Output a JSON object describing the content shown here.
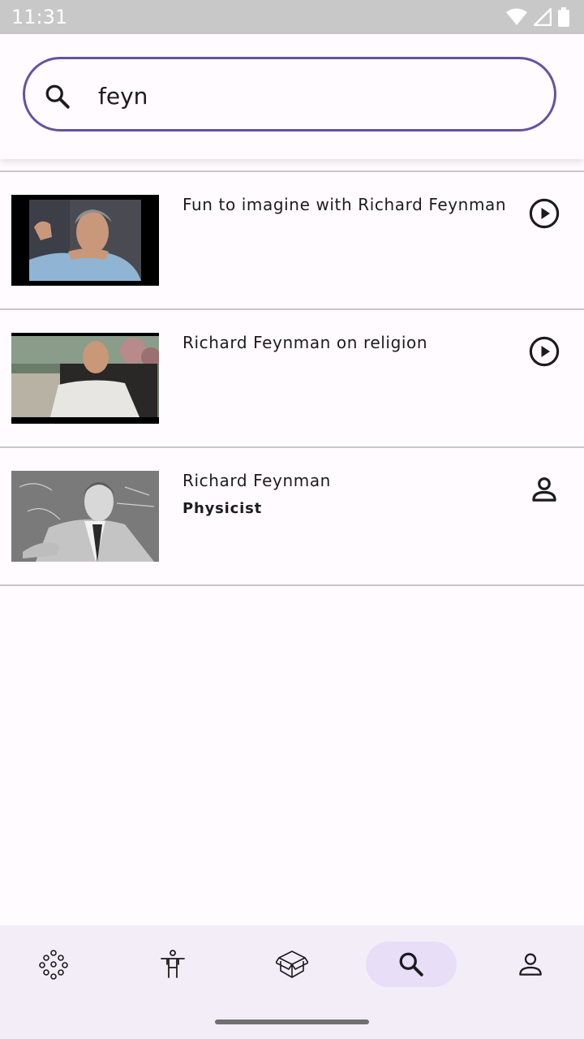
{
  "status_bar": {
    "time": "11:31"
  },
  "search": {
    "query": "feyn"
  },
  "results": [
    {
      "title": "Fun to imagine with Richard Feynman",
      "subtitle": "",
      "type": "video",
      "action_icon": "play-circle-icon"
    },
    {
      "title": "Richard Feynman on religion",
      "subtitle": "",
      "type": "video",
      "action_icon": "play-circle-icon"
    },
    {
      "title": "Richard Feynman",
      "subtitle": "Physicist",
      "type": "person",
      "action_icon": "person-icon"
    }
  ],
  "bottom_nav": {
    "items": [
      {
        "icon": "molecules-icon",
        "active": false
      },
      {
        "icon": "accessibility-icon",
        "active": false
      },
      {
        "icon": "box-icon",
        "active": false
      },
      {
        "icon": "search-icon",
        "active": true
      },
      {
        "icon": "person-icon",
        "active": false
      }
    ]
  },
  "colors": {
    "accent": "#6750a4",
    "active_pill": "#e8def8",
    "nav_bg": "#f3edf7"
  }
}
